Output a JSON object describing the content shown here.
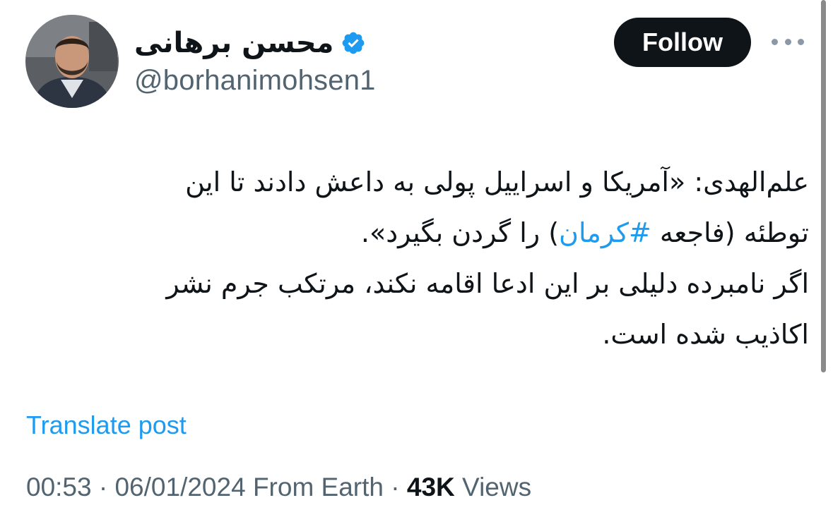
{
  "author": {
    "display_name": "محسن برهانی",
    "handle": "@borhanimohsen1",
    "verified_icon": "verified-badge-icon"
  },
  "actions": {
    "follow_label": "Follow",
    "more_icon": "more-dots-icon"
  },
  "tweet": {
    "line1": "علم‌الهدی: «آمریکا و اسراییل پولی به داعش دادند تا این",
    "line2_before": "توطئه (فاجعه ",
    "line2_hashtag": "#کرمان",
    "line2_after": ") را گردن بگیرد».",
    "line3": "اگر نامبرده دلیلی بر این ادعا اقامه نکند، مرتکب جرم نشر",
    "line4": "اکاذیب شده است."
  },
  "translate_label": "Translate post",
  "meta": {
    "time": "00:53",
    "separator1": " · ",
    "date": "06/01/2024",
    "source": " From Earth",
    "separator2": " · ",
    "views_count": "43K",
    "views_label": " Views"
  },
  "colors": {
    "text": "#0f1419",
    "secondary": "#536471",
    "accent": "#1d9bf0",
    "button_bg": "#0f1419"
  }
}
